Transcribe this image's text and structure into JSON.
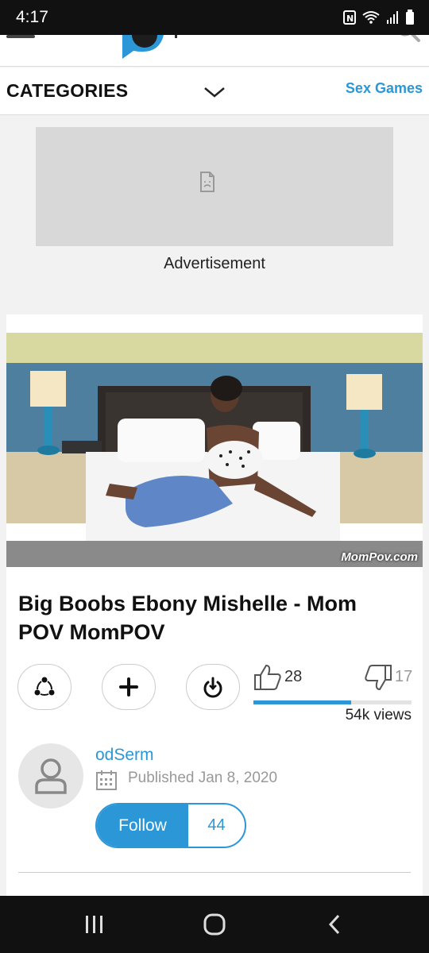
{
  "status_bar": {
    "time": "4:17",
    "icons": [
      "nfc-icon",
      "wifi-icon",
      "signal-icon",
      "battery-icon"
    ]
  },
  "header": {
    "icons": [
      "menu-icon",
      "logo-icon",
      "search-icon"
    ]
  },
  "categories": {
    "label": "CATEGORIES",
    "right_link": "Sex Games"
  },
  "ad": {
    "label": "Advertisement"
  },
  "video": {
    "watermark": "MomPov.com",
    "title": "Big Boobs Ebony Mishelle - Mom POV MomPOV",
    "actions": [
      "share-icon",
      "add-icon",
      "download-icon"
    ],
    "likes": "28",
    "dislikes": "17",
    "rating_fraction": 0.62,
    "views": "54k views"
  },
  "uploader": {
    "name": "odSerm",
    "published": "Published Jan 8, 2020",
    "follow_label": "Follow",
    "follower_count": "44"
  },
  "nav": {
    "icons": [
      "recent-apps-icon",
      "home-icon",
      "back-icon"
    ]
  },
  "colors": {
    "accent": "#2b97d6",
    "status_bar": "#111111"
  }
}
